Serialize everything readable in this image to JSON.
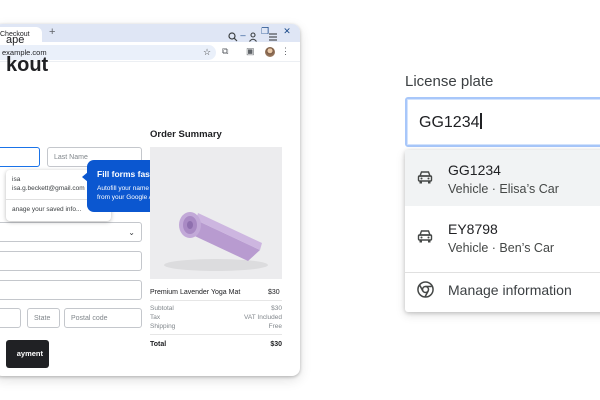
{
  "browser": {
    "tab_title": "Checkout",
    "new_tab_symbol": "+",
    "url": "example.com",
    "window_controls": [
      "_",
      "❐",
      "✕"
    ]
  },
  "site": {
    "brand": "ape",
    "headline": "kout"
  },
  "form": {
    "first_name_value": "",
    "last_name_placeholder": "Last Name",
    "state_placeholder": "State",
    "postal_placeholder": "Postal code",
    "pay_button": "ayment"
  },
  "autofill_popup": {
    "name": "isa",
    "email": "isa.g.beckett@gmail.com",
    "manage": "anage your saved info..."
  },
  "tooltip": {
    "title": "Fill forms faster",
    "body": "Autofill your name and email address from your Google Account",
    "close": "✕"
  },
  "order_summary": {
    "title": "Order Summary",
    "product_name": "Premium Lavender Yoga Mat",
    "product_price": "$30",
    "rows": [
      {
        "label": "Subtotal",
        "value": "$30"
      },
      {
        "label": "Tax",
        "value": "VAT Included"
      },
      {
        "label": "Shipping",
        "value": "Free"
      }
    ],
    "total_label": "Total",
    "total_value": "$30"
  },
  "license": {
    "label": "License plate",
    "value": "GG1234",
    "suggestions": [
      {
        "plate": "GG1234",
        "desc": "Vehicle · Elisa’s Car"
      },
      {
        "plate": "EY8798",
        "desc": "Vehicle · Ben’s Car"
      }
    ],
    "manage": "Manage information"
  },
  "colors": {
    "tooltip_blue": "#0b57d0",
    "focus_blue": "#1a73e8",
    "mat_lavender": "#c2a9d8"
  }
}
